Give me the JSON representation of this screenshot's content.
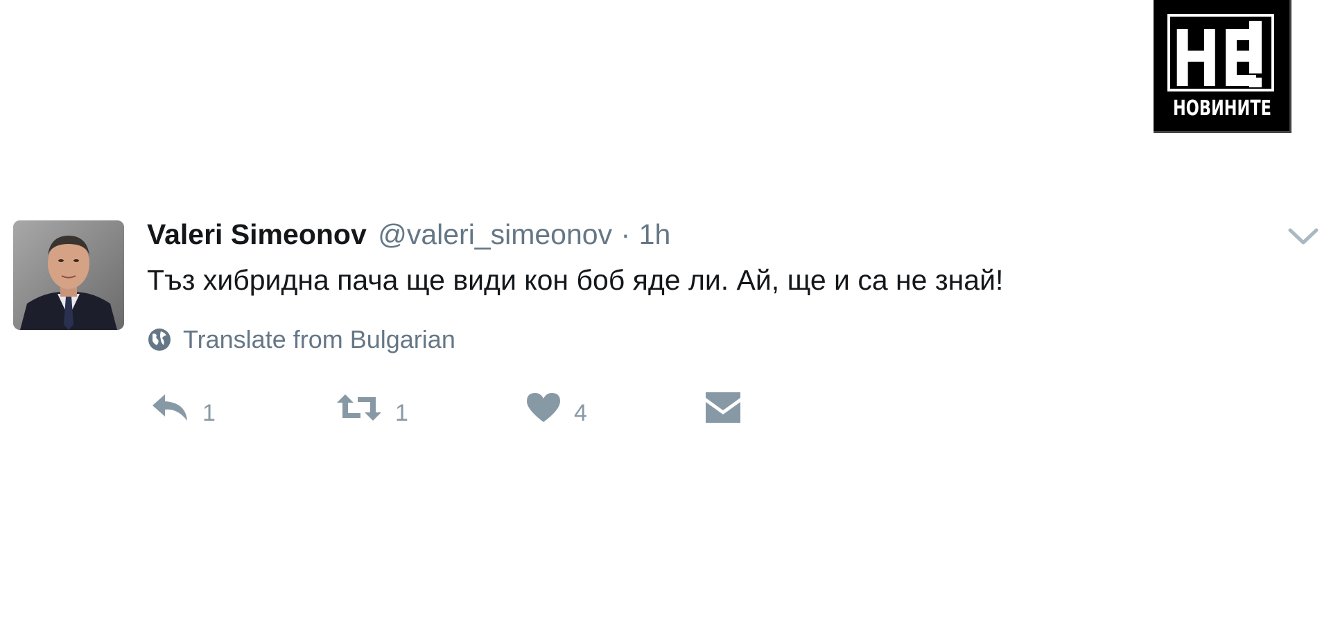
{
  "logo": {
    "text_top": "НЕ!",
    "text_bottom": "НОВИНИТЕ"
  },
  "tweet": {
    "display_name": "Valeri Simeonov",
    "handle": "@valeri_simeonov",
    "separator": "·",
    "time": "1h",
    "text": "Тъз хибридна пача ще види кон боб яде ли. Ай, ще и са не знай!",
    "translate_label": "Translate from Bulgarian",
    "actions": {
      "reply_count": "1",
      "retweet_count": "1",
      "like_count": "4"
    }
  },
  "colors": {
    "name": "#14171a",
    "secondary": "#657786",
    "action_icon": "#8899a6"
  },
  "icons": [
    "globe-icon",
    "reply-icon",
    "retweet-icon",
    "heart-icon",
    "envelope-icon",
    "chevron-down-icon"
  ]
}
